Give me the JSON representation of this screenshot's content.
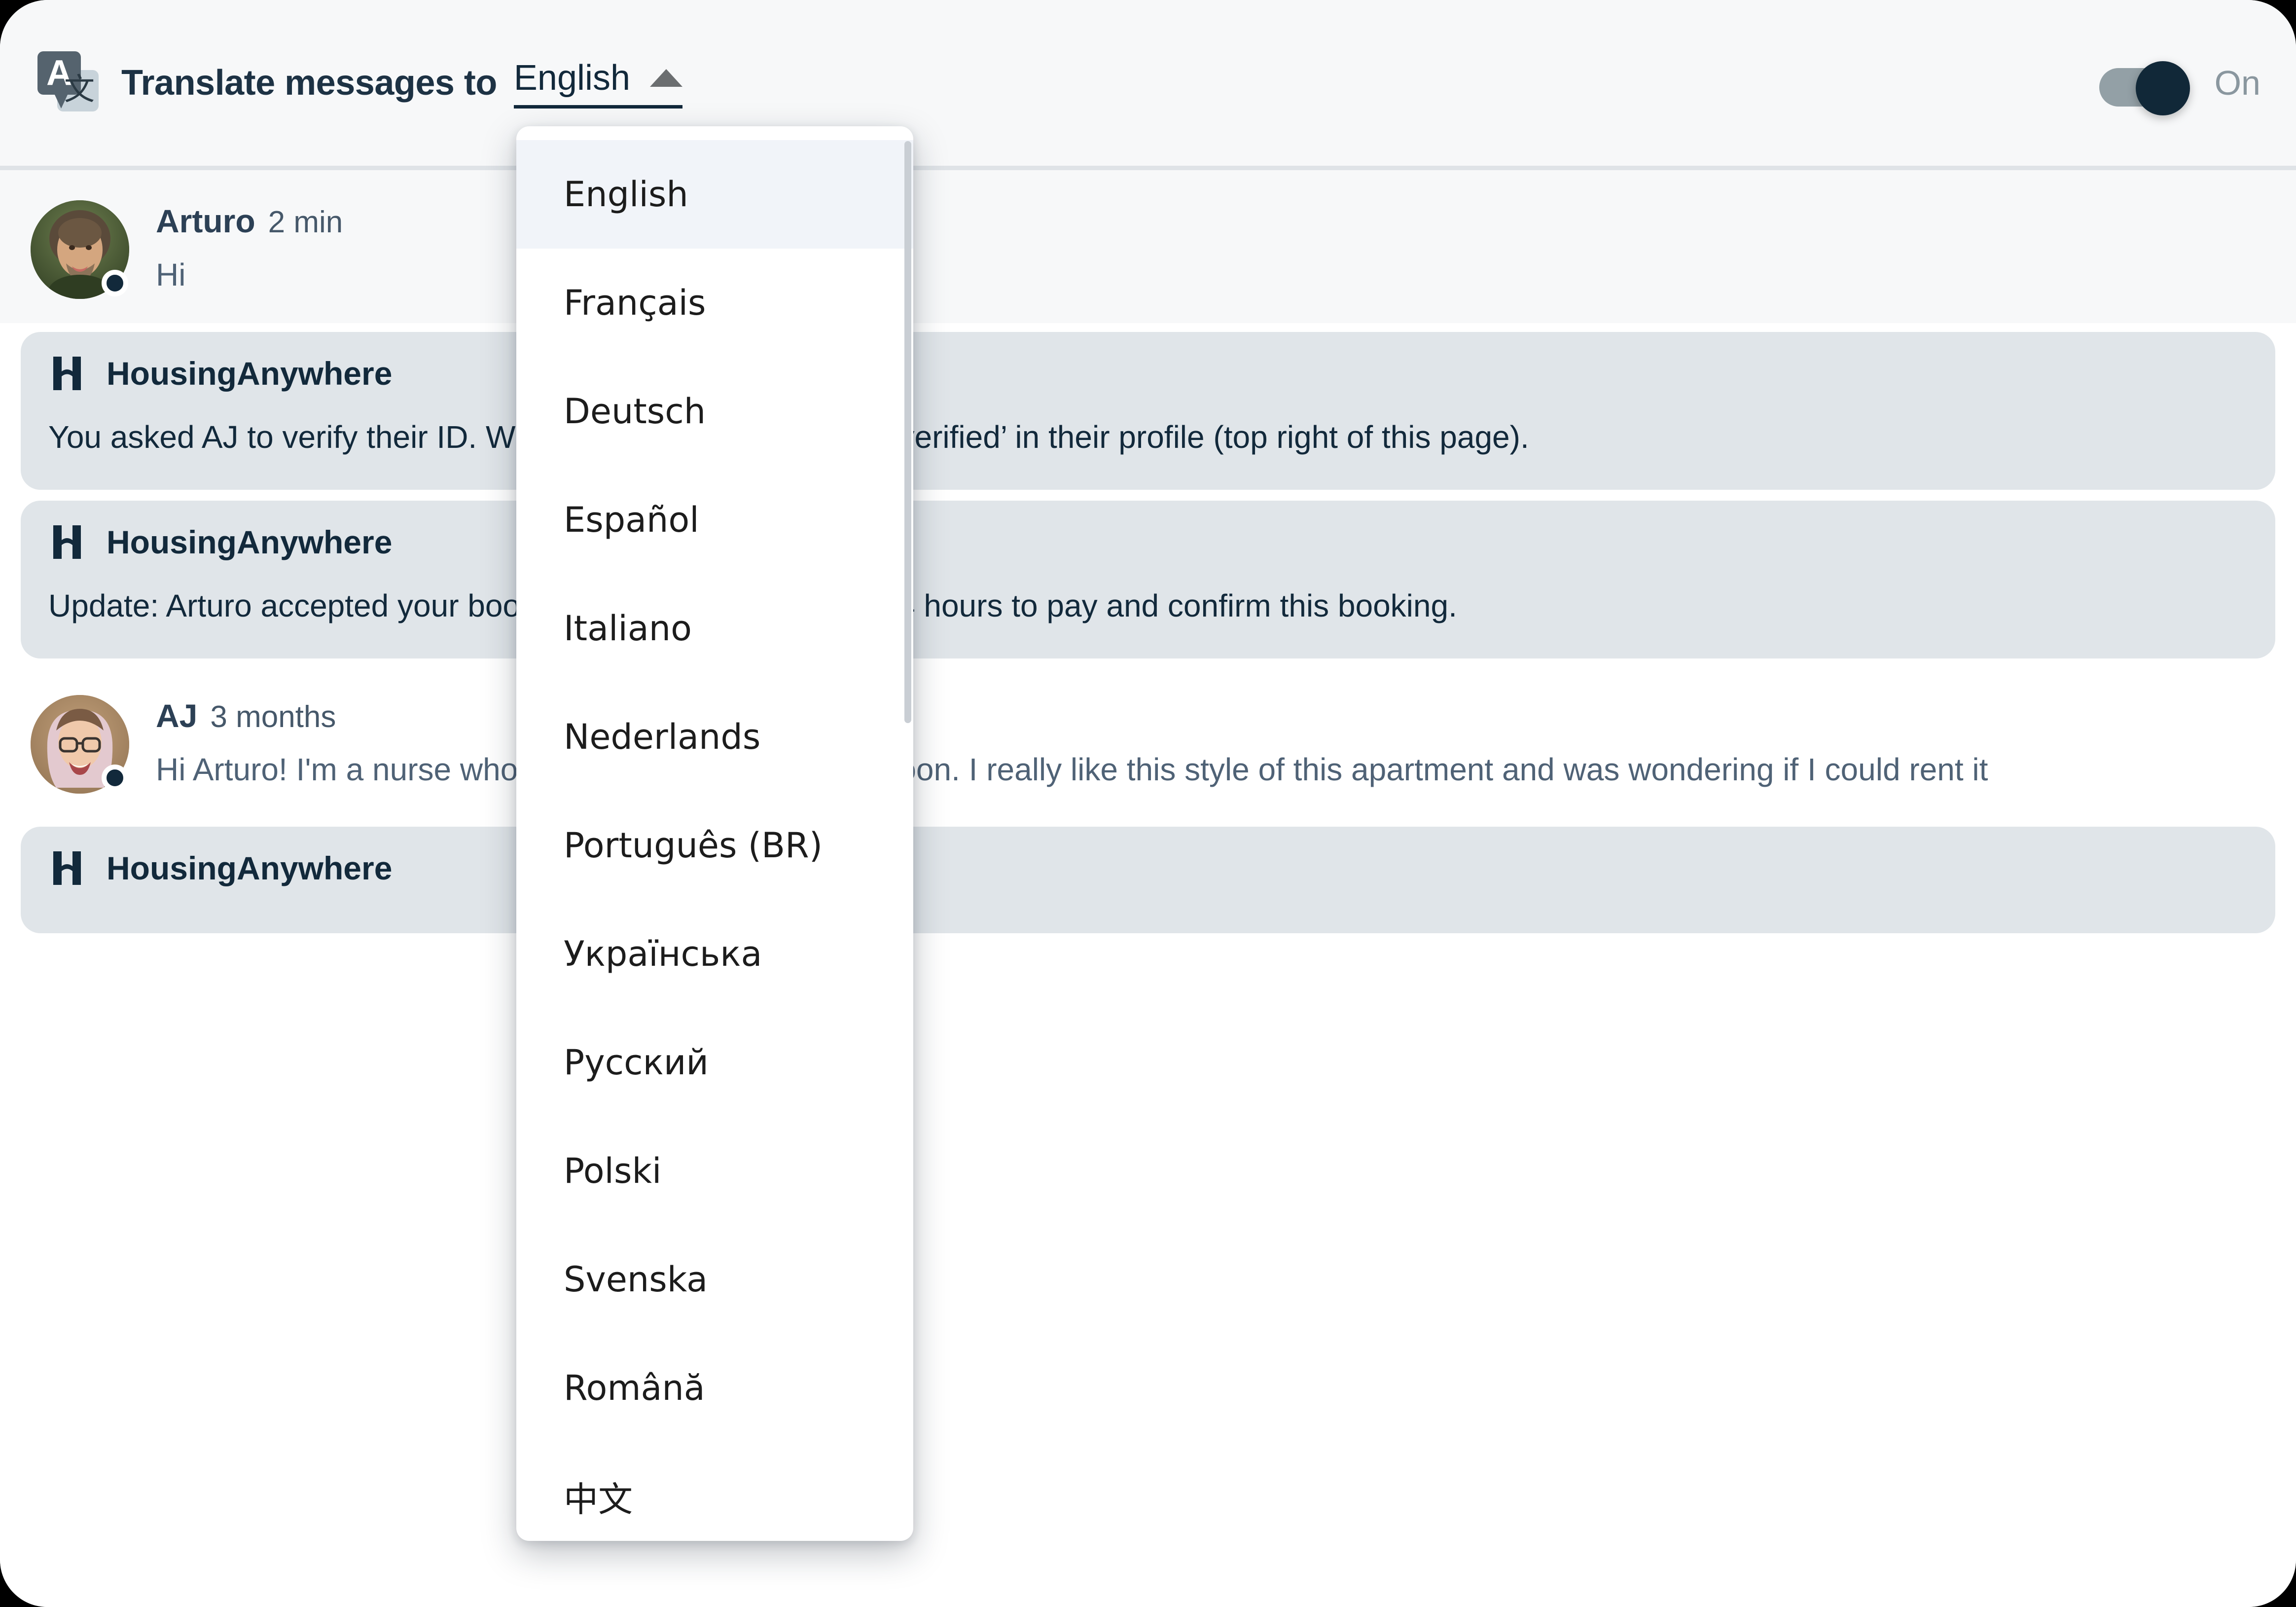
{
  "header": {
    "icon": "translate-icon",
    "icon_glyph_primary": "A",
    "icon_glyph_secondary": "文",
    "title": "Translate messages to",
    "selected_language": "English",
    "caret_icon": "caret-up-icon",
    "toggle_state_label": "On",
    "toggle_on": true,
    "accent_color": "#12293b",
    "track_color": "#93a0a6"
  },
  "language_dropdown": {
    "open": true,
    "selected_index": 0,
    "items": [
      {
        "label": "English"
      },
      {
        "label": "Français"
      },
      {
        "label": "Deutsch"
      },
      {
        "label": "Español"
      },
      {
        "label": "Italiano"
      },
      {
        "label": "Nederlands"
      },
      {
        "label": "Português (BR)"
      },
      {
        "label": "Українська"
      },
      {
        "label": "Русский"
      },
      {
        "label": "Polski"
      },
      {
        "label": "Svenska"
      },
      {
        "label": "Română"
      },
      {
        "label": "中文"
      }
    ]
  },
  "conversation": [
    {
      "kind": "user",
      "author": "Arturo",
      "time": "2 min",
      "text": "Hi",
      "avatar": "arturo-avatar",
      "online": true
    },
    {
      "kind": "system",
      "sender": "HousingAnywhere",
      "logo": "housinganywhere-logo-icon",
      "text": "You asked AJ to verify their ID. When it's done, you’ll see ‘ID verified’ in their profile (top right of this page)."
    },
    {
      "kind": "system",
      "sender": "HousingAnywhere",
      "logo": "housinganywhere-logo-icon",
      "text": "Update: Arturo accepted your booking request. AJ now has 24 hours to pay and confirm this booking."
    },
    {
      "kind": "user",
      "author": "AJ",
      "time": "3 months",
      "text": "Hi Arturo! I'm a nurse who will be moving to London soon. I really like this style of this apartment and was wondering if I could rent it",
      "avatar": "aj-avatar",
      "online": true
    },
    {
      "kind": "system",
      "sender": "HousingAnywhere",
      "logo": "housinganywhere-logo-icon",
      "text": ""
    }
  ]
}
